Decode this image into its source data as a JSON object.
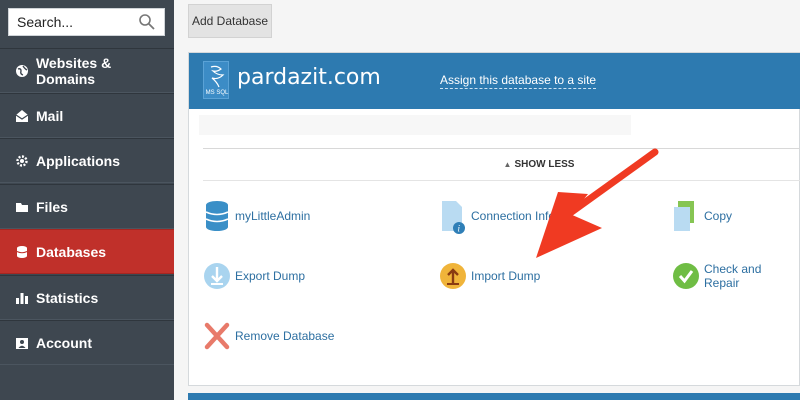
{
  "search": {
    "placeholder": "Search..."
  },
  "sidebar": {
    "items": [
      {
        "label": "Websites & Domains",
        "icon": "globe-icon"
      },
      {
        "label": "Mail",
        "icon": "mail-icon"
      },
      {
        "label": "Applications",
        "icon": "gear-icon"
      },
      {
        "label": "Files",
        "icon": "files-icon"
      },
      {
        "label": "Databases",
        "icon": "database-icon",
        "active": true
      },
      {
        "label": "Statistics",
        "icon": "bar-chart-icon"
      },
      {
        "label": "Account",
        "icon": "account-icon"
      }
    ]
  },
  "toolbar": {
    "add_database_label": "Add Database"
  },
  "database": {
    "badge": "MS SQL",
    "name": "pardazit.com",
    "assign_link": "Assign this database to a site",
    "show_less": "SHOW LESS"
  },
  "tools": [
    {
      "label": "myLittleAdmin",
      "icon": "database-stack-icon"
    },
    {
      "label": "Connection Info",
      "icon": "info-document-icon"
    },
    {
      "label": "Copy",
      "icon": "copy-icon"
    },
    {
      "label": "Export Dump",
      "icon": "export-icon"
    },
    {
      "label": "Import Dump",
      "icon": "import-icon"
    },
    {
      "label": "Check and Repair",
      "icon": "check-icon"
    },
    {
      "label": "Remove Database",
      "icon": "remove-icon"
    }
  ],
  "colors": {
    "sidebar_bg": "#3e4750",
    "active_item": "#c0302a",
    "panel_header": "#2d7ab0",
    "link": "#2d6fa1",
    "annotation_arrow": "#f03a22"
  }
}
